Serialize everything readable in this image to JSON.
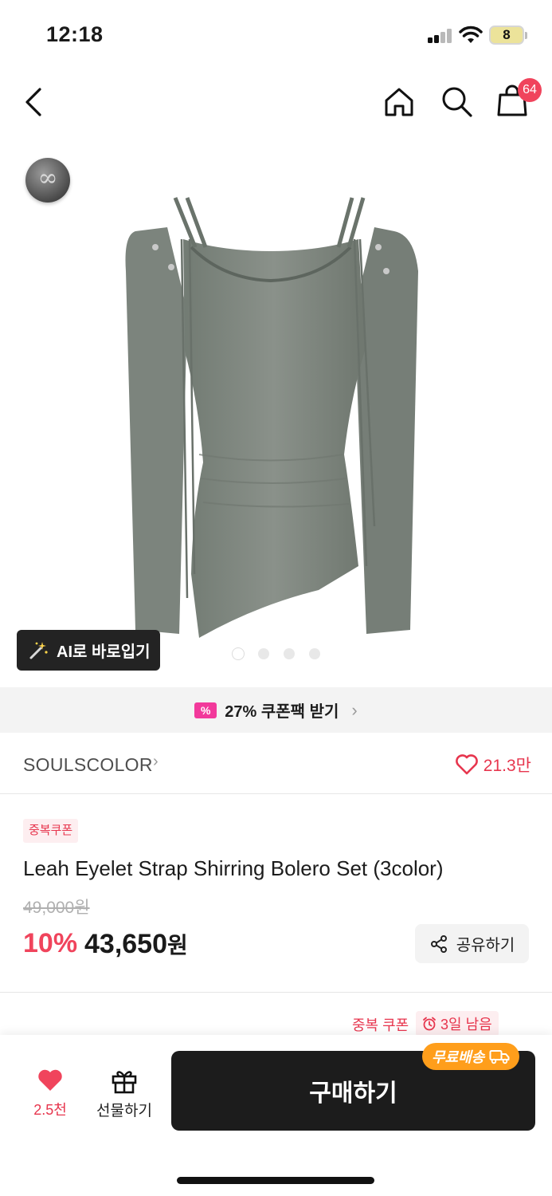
{
  "status": {
    "time": "12:18",
    "battery": "8"
  },
  "nav": {
    "cart_badge": "64"
  },
  "hero": {
    "ai_button_label": "AI로 바로입기",
    "page_count": 4,
    "active_page": 1
  },
  "coupon_strip": {
    "label": "27% 쿠폰팩 받기"
  },
  "brand": {
    "name": "SOULSCOLOR",
    "likes": "21.3만"
  },
  "product": {
    "tag": "중복쿠폰",
    "title": "Leah Eyelet Strap Shirring Bolero Set (3color)",
    "original_price": "49,000원",
    "discount": "10%",
    "sale_price": "43,650",
    "currency": "원",
    "share_label": "공유하기"
  },
  "coupon_info": {
    "label": "중복 쿠폰",
    "days_left": "3일 남음"
  },
  "bottom": {
    "wish_count": "2.5천",
    "gift_label": "선물하기",
    "buy_label": "구매하기",
    "free_shipping": "무료배송"
  },
  "colors": {
    "accent": "#f0445c",
    "dark": "#1c1c1c",
    "ship": "#ff9e1b",
    "coupon_pink": "#f2399b"
  }
}
